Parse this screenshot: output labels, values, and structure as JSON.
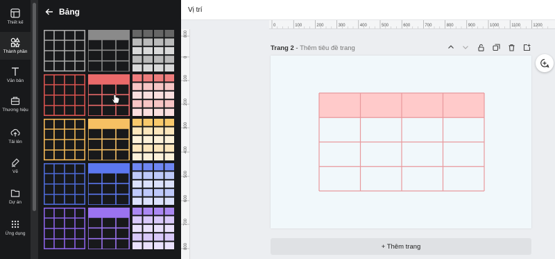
{
  "sidebar": {
    "items": [
      {
        "label": "Thiết kế",
        "icon": "design-icon"
      },
      {
        "label": "Thành phần",
        "icon": "elements-icon",
        "active": true
      },
      {
        "label": "Văn bản",
        "icon": "text-icon"
      },
      {
        "label": "Thương hiệu",
        "icon": "brand-icon"
      },
      {
        "label": "Tải lên",
        "icon": "upload-icon"
      },
      {
        "label": "Vẽ",
        "icon": "draw-icon"
      },
      {
        "label": "Dự án",
        "icon": "folder-icon"
      },
      {
        "label": "Ứng dụng",
        "icon": "apps-icon"
      }
    ]
  },
  "panel": {
    "title": "Bảng",
    "back_icon": "arrow-left-icon",
    "tables": [
      {
        "style": "plain",
        "header": "none",
        "color": "#aaaaaa"
      },
      {
        "style": "header",
        "header": "filled",
        "color": "#8a8a8a"
      },
      {
        "style": "filled",
        "header": "filled",
        "color": "#666666"
      },
      {
        "style": "plain",
        "header": "none",
        "color": "#d9534f"
      },
      {
        "style": "header",
        "header": "filled",
        "color": "#ea6a6a"
      },
      {
        "style": "filled",
        "header": "filled",
        "color": "#ee7d7d"
      },
      {
        "style": "plain",
        "header": "none",
        "color": "#f3b756"
      },
      {
        "style": "header",
        "header": "filled",
        "color": "#f6c063"
      },
      {
        "style": "filled",
        "header": "filled",
        "color": "#f8c96c"
      },
      {
        "style": "plain",
        "header": "none",
        "color": "#4e6ad8"
      },
      {
        "style": "header",
        "header": "filled",
        "color": "#5c78f0"
      },
      {
        "style": "filled",
        "header": "filled",
        "color": "#6f87f3"
      },
      {
        "style": "plain",
        "header": "none",
        "color": "#8a62e6"
      },
      {
        "style": "header",
        "header": "filled",
        "color": "#9b73f0"
      },
      {
        "style": "filled",
        "header": "filled",
        "color": "#ab88f3"
      }
    ]
  },
  "topbar": {
    "title": "Vị trí"
  },
  "ruler": {
    "top_ticks": [
      "0",
      "100",
      "200",
      "300",
      "400",
      "500",
      "600",
      "700",
      "800",
      "900",
      "1000",
      "1100",
      "1200"
    ],
    "left_ticks": [
      "800",
      "0",
      "100",
      "200",
      "300",
      "400",
      "500",
      "600",
      "700",
      "800"
    ]
  },
  "page": {
    "label": "Trang 2",
    "separator": " - ",
    "title_placeholder": "Thêm tiêu đề trang",
    "table": {
      "rows": 4,
      "cols": 4,
      "header_color": "#ffcaca",
      "line_color": "#e8999d"
    }
  },
  "page_tools": [
    "chevron-up-icon",
    "chevron-down-icon",
    "lock-icon",
    "duplicate-icon",
    "trash-icon",
    "add-page-icon"
  ],
  "add_page_label": "+ Thêm trang",
  "colors": {
    "sidebar_bg": "#18191b",
    "canvas_bg": "#eceef1",
    "page_bg": "#f1f8fb"
  }
}
